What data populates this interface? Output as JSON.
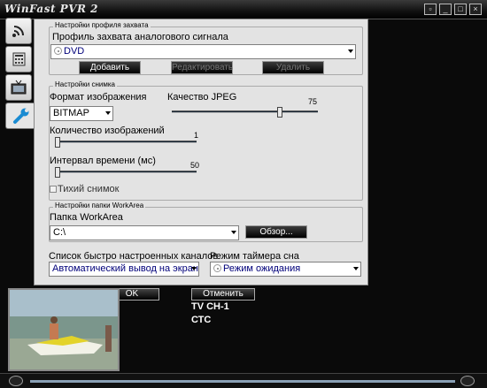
{
  "window": {
    "title": "WinFast PVR 2",
    "controls": [
      "restore-icon",
      "minimize-icon",
      "maximize-icon",
      "close-icon"
    ]
  },
  "tabs": [
    {
      "name": "signal-icon"
    },
    {
      "name": "keypad-icon"
    },
    {
      "name": "tv-icon"
    },
    {
      "name": "wrench-icon",
      "active": true
    }
  ],
  "capture_profile": {
    "legend": "Настройки профиля захвата",
    "label": "Профиль захвата аналогового сигнала",
    "value": "DVD",
    "buttons": {
      "add": "Добавить",
      "edit": "Редактировать",
      "delete": "Удалить"
    }
  },
  "snapshot": {
    "legend": "Настройки снимка",
    "format_label": "Формат изображения",
    "format_value": "BITMAP",
    "jpeg_label": "Качество JPEG",
    "jpeg_value": "75",
    "jpeg_level": 75,
    "count_label": "Количество изображений",
    "count_value": "1",
    "count_level": 0,
    "interval_label": "Интервал времени (мс)",
    "interval_value": "50",
    "interval_level": 0,
    "silent_label": "Тихий снимок"
  },
  "workarea": {
    "legend": "Настройки папки WorkArea",
    "label": "Папка WorkArea",
    "value": "C:\\",
    "browse": "Обзор..."
  },
  "channels": {
    "label": "Список быстро настроенных каналов",
    "value": "Автоматический вывод на экран"
  },
  "sleep_timer": {
    "label": "Режим таймера сна",
    "value": "Режим ожидания"
  },
  "bottom": {
    "ok": "OK",
    "cancel": "Отменить",
    "channel": "TV CH-1",
    "station": "СТС"
  },
  "colors": {
    "panel": "#e3e3e3",
    "frame": "#000000",
    "combo_text": "#00007a"
  }
}
